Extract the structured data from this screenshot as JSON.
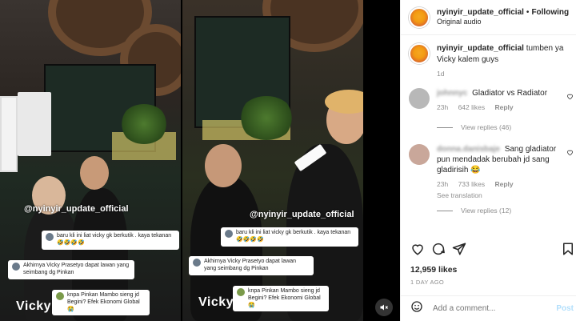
{
  "media": {
    "watermark": "@nyinyir_update_official",
    "name_overlay": "Vicky",
    "left_comments": [
      {
        "text": "baru kli ini liat vicky gk berkutik . kaya tekanan",
        "emoji": "🤣🤣🤣🤣"
      },
      {
        "text": "Akhirnya Vicky Prasetyo dapat lawan yang seimbang dg Pinkan",
        "emoji": ""
      },
      {
        "text": "knpa Pinkan Mambo sieng jd Begini? Efek Ekonomi Global",
        "emoji": "😭"
      }
    ],
    "right_comments": [
      {
        "text": "baru kli ini liat vicky gk berkutik . kaya tekanan",
        "emoji": "🤣🤣🤣🤣"
      },
      {
        "text": "Akhirnya Vicky Prasetyo dapat lawan yang seimbang dg Pinkan",
        "emoji": ""
      },
      {
        "text": "knpa Pinkan Mambo sieng jd Begini? Efek Ekonomi Global",
        "emoji": "😭"
      }
    ],
    "mute_icon": "speaker-muted-icon"
  },
  "header": {
    "username": "nyinyir_update_official",
    "separator": "•",
    "follow_label": "Following",
    "audio": "Original audio"
  },
  "caption": {
    "username": "nyinyir_update_official",
    "text": "tumben ya Vicky kalem guys",
    "age": "1d"
  },
  "comments": [
    {
      "username": "johnnyc",
      "text": "Gladiator vs Radiator",
      "age": "23h",
      "likes": "642 likes",
      "reply": "Reply",
      "view_replies": "View replies (46)",
      "avatar_color": "#b8b8b8"
    },
    {
      "username": "donna.danisbaje",
      "text": "Sang gladiator pun mendadak berubah jd sang gladirisih 😂",
      "age": "23h",
      "likes": "733 likes",
      "reply": "Reply",
      "see_translation": "See translation",
      "view_replies": "View replies (12)",
      "avatar_color": "#c9a79a"
    }
  ],
  "actions": {
    "like_icon": "heart-icon",
    "comment_icon": "comment-icon",
    "share_icon": "send-icon",
    "save_icon": "bookmark-icon"
  },
  "likes": "12,959 likes",
  "date": "1 DAY AGO",
  "add_comment": {
    "placeholder": "Add a comment...",
    "post_label": "Post",
    "emoji_icon": "smiley-icon"
  }
}
